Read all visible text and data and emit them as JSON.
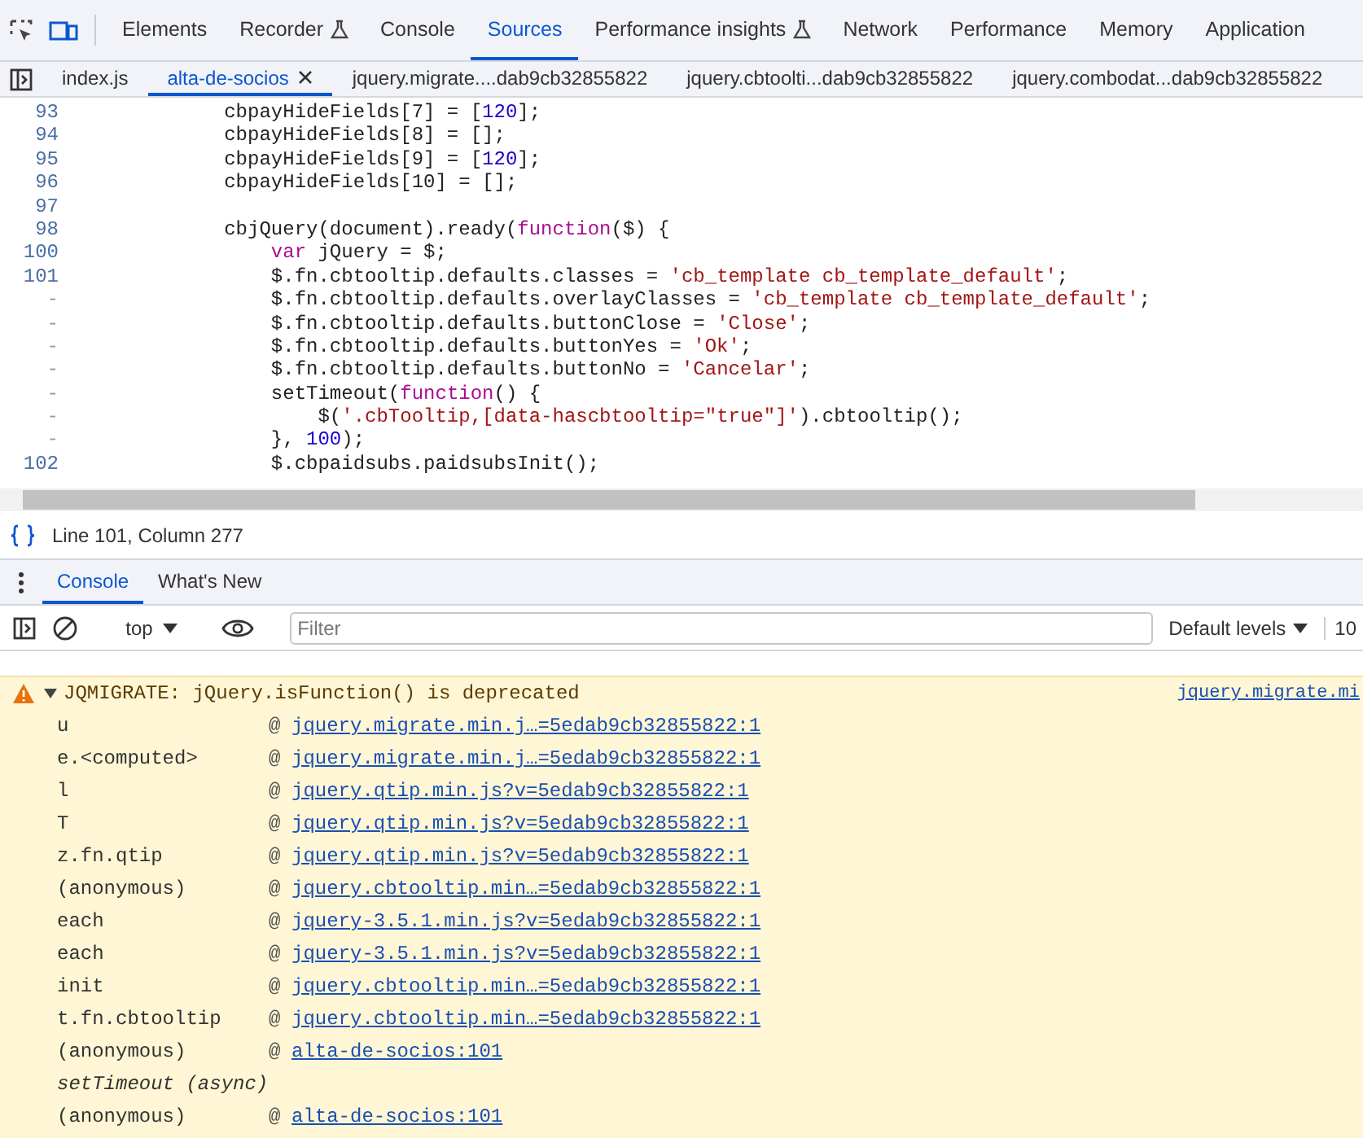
{
  "main_tabs": [
    {
      "label": "Elements",
      "selected": false,
      "experimental": false
    },
    {
      "label": "Recorder",
      "selected": false,
      "experimental": true
    },
    {
      "label": "Console",
      "selected": false,
      "experimental": false
    },
    {
      "label": "Sources",
      "selected": true,
      "experimental": false
    },
    {
      "label": "Performance insights",
      "selected": false,
      "experimental": true
    },
    {
      "label": "Network",
      "selected": false,
      "experimental": false
    },
    {
      "label": "Performance",
      "selected": false,
      "experimental": false
    },
    {
      "label": "Memory",
      "selected": false,
      "experimental": false
    },
    {
      "label": "Application",
      "selected": false,
      "experimental": false
    }
  ],
  "file_tabs": [
    {
      "label": "index.js",
      "selected": false,
      "closable": false
    },
    {
      "label": "alta-de-socios",
      "selected": true,
      "closable": true
    },
    {
      "label": "jquery.migrate....dab9cb32855822",
      "selected": false,
      "closable": false
    },
    {
      "label": "jquery.cbtoolti...dab9cb32855822",
      "selected": false,
      "closable": false
    },
    {
      "label": "jquery.combodat...dab9cb32855822",
      "selected": false,
      "closable": false
    }
  ],
  "code_lines": [
    {
      "number": "93",
      "segments": [
        {
          "kind": "plain",
          "text": "        cbpayHideFields[7] = ["
        },
        {
          "kind": "number",
          "text": "120"
        },
        {
          "kind": "plain",
          "text": "];"
        }
      ]
    },
    {
      "number": "94",
      "segments": [
        {
          "kind": "plain",
          "text": "        cbpayHideFields[8] = [];"
        }
      ]
    },
    {
      "number": "95",
      "segments": [
        {
          "kind": "plain",
          "text": "        cbpayHideFields[9] = ["
        },
        {
          "kind": "number",
          "text": "120"
        },
        {
          "kind": "plain",
          "text": "];"
        }
      ]
    },
    {
      "number": "96",
      "segments": [
        {
          "kind": "plain",
          "text": "        cbpayHideFields[10] = [];"
        }
      ]
    },
    {
      "number": "97"
    },
    {
      "number": "98",
      "segments": [
        {
          "kind": "plain",
          "text": "        cbjQuery(document).ready("
        },
        {
          "kind": "keyword",
          "text": "function"
        },
        {
          "kind": "plain",
          "text": "($) {"
        }
      ]
    },
    {
      "number": "100",
      "segments": [
        {
          "kind": "keyword",
          "text": "            var"
        },
        {
          "kind": "plain",
          "text": " jQuery = $;"
        }
      ]
    },
    {
      "number": "101",
      "segments": [
        {
          "kind": "plain",
          "text": "            $.fn.cbtooltip.defaults.classes = "
        },
        {
          "kind": "string",
          "text": "'cb_template cb_template_default'"
        },
        {
          "kind": "plain",
          "text": ";"
        }
      ]
    },
    {
      "number": "-",
      "segments": [
        {
          "kind": "plain",
          "text": "            $.fn.cbtooltip.defaults.overlayClasses = "
        },
        {
          "kind": "string",
          "text": "'cb_template cb_template_default'"
        },
        {
          "kind": "plain",
          "text": ";"
        }
      ]
    },
    {
      "number": "-",
      "segments": [
        {
          "kind": "plain",
          "text": "            $.fn.cbtooltip.defaults.buttonClose = "
        },
        {
          "kind": "string",
          "text": "'Close'"
        },
        {
          "kind": "plain",
          "text": ";"
        }
      ]
    },
    {
      "number": "-",
      "segments": [
        {
          "kind": "plain",
          "text": "            $.fn.cbtooltip.defaults.buttonYes = "
        },
        {
          "kind": "string",
          "text": "'Ok'"
        },
        {
          "kind": "plain",
          "text": ";"
        }
      ]
    },
    {
      "number": "-",
      "segments": [
        {
          "kind": "plain",
          "text": "            $.fn.cbtooltip.defaults.buttonNo = "
        },
        {
          "kind": "string",
          "text": "'Cancelar'"
        },
        {
          "kind": "plain",
          "text": ";"
        }
      ]
    },
    {
      "number": "-",
      "segments": [
        {
          "kind": "plain",
          "text": "            setTimeout("
        },
        {
          "kind": "keyword",
          "text": "function"
        },
        {
          "kind": "plain",
          "text": "() {"
        }
      ]
    },
    {
      "number": "-",
      "segments": [
        {
          "kind": "plain",
          "text": "                $("
        },
        {
          "kind": "string",
          "text": "'.cbTooltip,[data-hascbtooltip=\"true\"]'"
        },
        {
          "kind": "plain",
          "text": ").cbtooltip();"
        }
      ]
    },
    {
      "number": "-",
      "segments": [
        {
          "kind": "plain",
          "text": "            }, "
        },
        {
          "kind": "number",
          "text": "100"
        },
        {
          "kind": "plain",
          "text": ");"
        }
      ]
    },
    {
      "number": "102",
      "segments": [
        {
          "kind": "plain",
          "text": "            $.cbpaidsubs.paidsubsInit();"
        }
      ]
    }
  ],
  "status": "Line 101, Column 277",
  "drawer_tabs": [
    {
      "label": "Console",
      "selected": true
    },
    {
      "label": "What's New",
      "selected": false
    }
  ],
  "console_toolbar": {
    "context": "top",
    "filter_placeholder": "Filter",
    "levels": "Default levels",
    "count": "10"
  },
  "warning": {
    "message": "JQMIGRATE: jQuery.isFunction() is deprecated",
    "source": "jquery.migrate.mi",
    "expanded": true,
    "stack": [
      {
        "kind": "frame",
        "fn": "u",
        "at": "@",
        "link": "jquery.migrate.min.j…=5edab9cb32855822:1"
      },
      {
        "kind": "frame",
        "fn": "e.<computed>",
        "at": "@",
        "link": "jquery.migrate.min.j…=5edab9cb32855822:1"
      },
      {
        "kind": "frame",
        "fn": "l",
        "at": "@",
        "link": "jquery.qtip.min.js?v=5edab9cb32855822:1"
      },
      {
        "kind": "frame",
        "fn": "T",
        "at": "@",
        "link": "jquery.qtip.min.js?v=5edab9cb32855822:1"
      },
      {
        "kind": "frame",
        "fn": "z.fn.qtip",
        "at": "@",
        "link": "jquery.qtip.min.js?v=5edab9cb32855822:1"
      },
      {
        "kind": "frame",
        "fn": "(anonymous)",
        "at": "@",
        "link": "jquery.cbtooltip.min…=5edab9cb32855822:1"
      },
      {
        "kind": "frame",
        "fn": "each",
        "at": "@",
        "link": "jquery-3.5.1.min.js?v=5edab9cb32855822:1"
      },
      {
        "kind": "frame",
        "fn": "each",
        "at": "@",
        "link": "jquery-3.5.1.min.js?v=5edab9cb32855822:1"
      },
      {
        "kind": "frame",
        "fn": "init",
        "at": "@",
        "link": "jquery.cbtooltip.min…=5edab9cb32855822:1"
      },
      {
        "kind": "frame",
        "fn": "t.fn.cbtooltip",
        "at": "@",
        "link": "jquery.cbtooltip.min…=5edab9cb32855822:1"
      },
      {
        "kind": "frame",
        "fn": "(anonymous)",
        "at": "@",
        "link": "alta-de-socios:101"
      },
      {
        "kind": "async",
        "fn": "setTimeout (async)"
      },
      {
        "kind": "frame",
        "fn": "(anonymous)",
        "at": "@",
        "link": "alta-de-socios:101"
      }
    ]
  }
}
